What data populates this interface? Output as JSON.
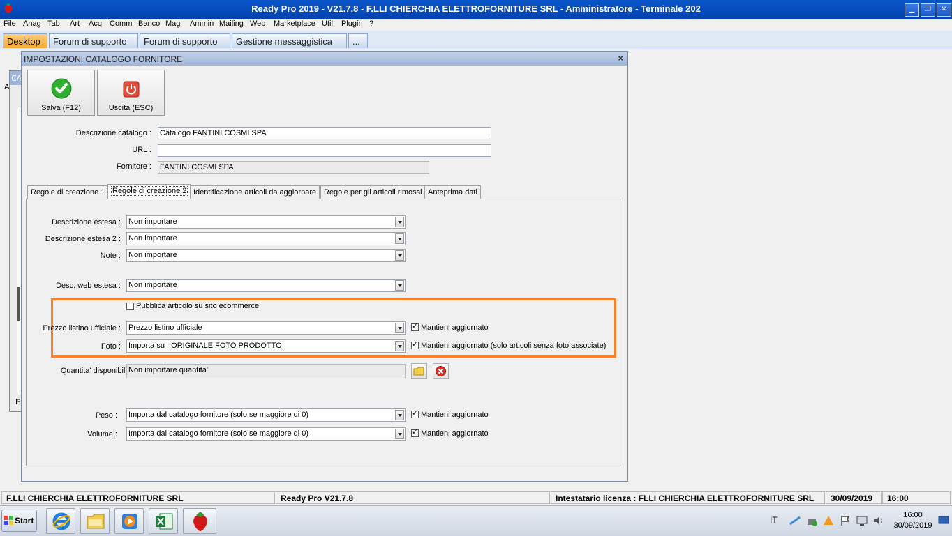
{
  "window": {
    "title": "Ready Pro 2019 - V21.7.8 - F.LLI CHIERCHIA ELETTROFORNITURE SRL - Amministratore - Terminale 202"
  },
  "menu": [
    "File",
    "Anag",
    "Tab",
    "Art",
    "Acq",
    "Comm",
    "Banco",
    "Mag",
    "Ammin",
    "Mailing",
    "Web",
    "Marketplace",
    "Util",
    "Plugin",
    "?"
  ],
  "top_tabs": [
    "Desktop",
    "Forum di supporto",
    "Forum di supporto",
    "Gestione messaggistica",
    "..."
  ],
  "background_window": {
    "fragments": [
      "CA",
      "A",
      "F"
    ]
  },
  "dialog": {
    "title": "IMPOSTAZIONI CATALOGO FORNITORE",
    "close": "×",
    "save_label": "Salva (F12)",
    "exit_label": "Uscita (ESC)",
    "fields": {
      "descrizione_label": "Descrizione catalogo :",
      "descrizione_value": "Catalogo FANTINI COSMI SPA",
      "url_label": "URL :",
      "url_value": "",
      "fornitore_label": "Fornitore :",
      "fornitore_value": "FANTINI COSMI SPA"
    },
    "tabs": [
      "Regole di creazione 1",
      "Regole di creazione 2",
      "Identificazione articoli da aggiornare",
      "Regole per gli articoli rimossi",
      "Anteprima dati"
    ],
    "active_tab": "Regole di creazione 2",
    "panel": {
      "desc_estesa_label": "Descrizione estesa :",
      "desc_estesa_value": "Non importare",
      "desc_estesa2_label": "Descrizione estesa 2 :",
      "desc_estesa2_value": "Non importare",
      "note_label": "Note :",
      "note_value": "Non importare",
      "desc_web_label": "Desc. web estesa :",
      "desc_web_value": "Non importare",
      "pubblica_label": "Pubblica articolo su sito ecommerce",
      "pubblica_checked": false,
      "prezzo_label": "Prezzo listino ufficiale :",
      "prezzo_value": "Prezzo listino ufficiale",
      "prezzo_keep_label": "Mantieni aggiornato",
      "foto_label": "Foto :",
      "foto_value": "Importa su : ORIGINALE FOTO PRODOTTO",
      "foto_keep_label": "Mantieni aggiornato (solo articoli senza foto associate)",
      "quantita_label": "Quantita' disponibili :",
      "quantita_value": "Non importare quantita'",
      "peso_label": "Peso :",
      "peso_value": "Importa dal catalogo fornitore (solo se maggiore di 0)",
      "peso_keep_label": "Mantieni aggiornato",
      "volume_label": "Volume :",
      "volume_value": "Importa dal catalogo fornitore (solo se maggiore di 0)",
      "volume_keep_label": "Mantieni aggiornato"
    },
    "highlight_color": "#f6822d"
  },
  "status": {
    "company": "F.LLI CHIERCHIA ELETTROFORNITURE SRL",
    "version": "Ready Pro V21.7.8",
    "license": "Intestatario licenza : FLLI CHIERCHIA ELETTROFORNITURE SRL",
    "date": "30/09/2019",
    "time": "16:00"
  },
  "taskbar": {
    "start_label": "Start",
    "lang": "IT",
    "clock_time": "16:00",
    "clock_date": "30/09/2019"
  }
}
